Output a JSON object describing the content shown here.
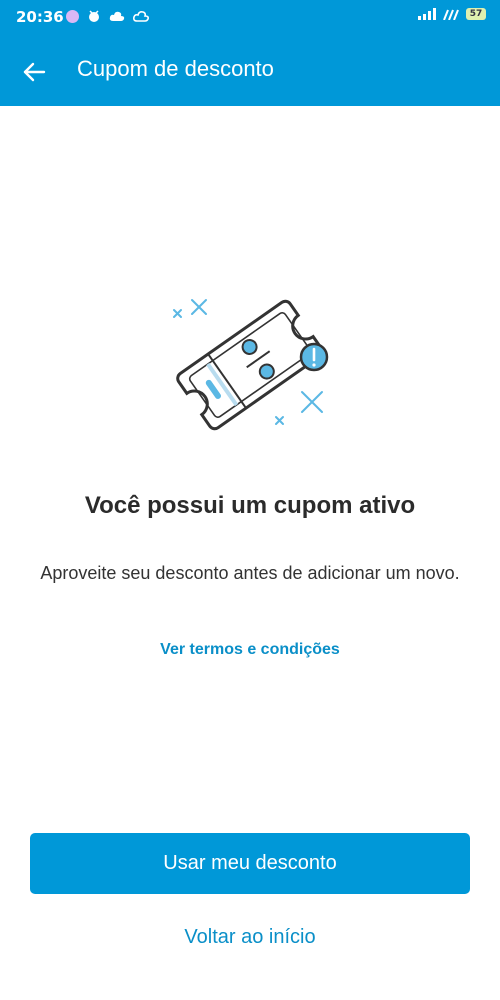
{
  "status_bar": {
    "time": "20:36",
    "battery": "57"
  },
  "header": {
    "title": "Cupom de desconto"
  },
  "main": {
    "headline": "Você possui um cupom ativo",
    "description": "Aproveite seu desconto antes de adicionar um novo.",
    "terms_link": "Ver termos e condições"
  },
  "actions": {
    "primary_label": "Usar meu desconto",
    "secondary_label": "Voltar ao início"
  },
  "colors": {
    "brand": "#0098d8",
    "link": "#0a8fc8",
    "text": "#2b2b2b"
  },
  "icons": [
    "back-arrow-icon",
    "coupon-icon",
    "alert-icon",
    "sparkle-x-icon"
  ]
}
